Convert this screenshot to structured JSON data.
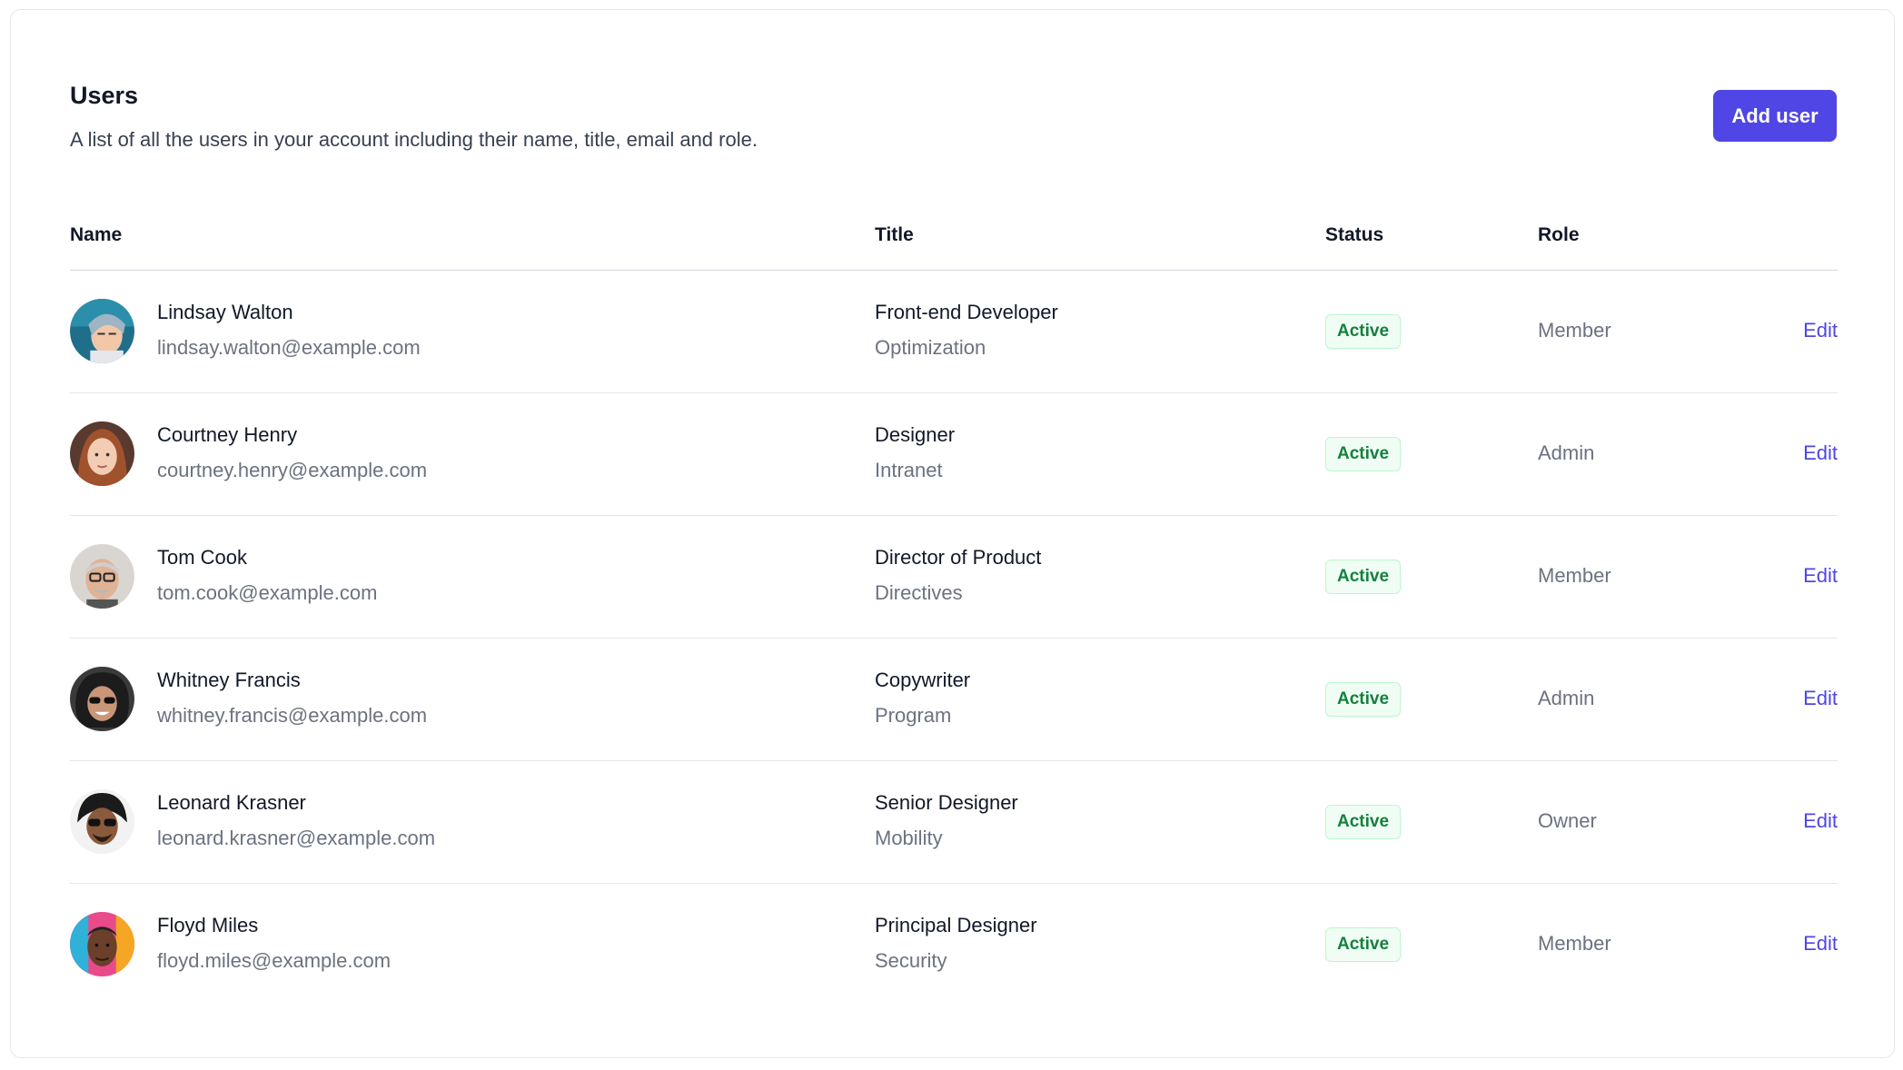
{
  "header": {
    "title": "Users",
    "subtitle": "A list of all the users in your account including their name, title, email and role.",
    "add_button_label": "Add user"
  },
  "table": {
    "columns": [
      "Name",
      "Title",
      "Status",
      "Role"
    ],
    "rows": [
      {
        "name": "Lindsay Walton",
        "email": "lindsay.walton@example.com",
        "title": "Front-end Developer",
        "department": "Optimization",
        "status": "Active",
        "role": "Member",
        "action": "Edit"
      },
      {
        "name": "Courtney Henry",
        "email": "courtney.henry@example.com",
        "title": "Designer",
        "department": "Intranet",
        "status": "Active",
        "role": "Admin",
        "action": "Edit"
      },
      {
        "name": "Tom Cook",
        "email": "tom.cook@example.com",
        "title": "Director of Product",
        "department": "Directives",
        "status": "Active",
        "role": "Member",
        "action": "Edit"
      },
      {
        "name": "Whitney Francis",
        "email": "whitney.francis@example.com",
        "title": "Copywriter",
        "department": "Program",
        "status": "Active",
        "role": "Admin",
        "action": "Edit"
      },
      {
        "name": "Leonard Krasner",
        "email": "leonard.krasner@example.com",
        "title": "Senior Designer",
        "department": "Mobility",
        "status": "Active",
        "role": "Owner",
        "action": "Edit"
      },
      {
        "name": "Floyd Miles",
        "email": "floyd.miles@example.com",
        "title": "Principal Designer",
        "department": "Security",
        "status": "Active",
        "role": "Member",
        "action": "Edit"
      }
    ]
  },
  "colors": {
    "accent": "#4f46e5",
    "badge_bg": "#f0fdf4",
    "badge_text": "#15803d",
    "badge_border": "#bbf7d0"
  }
}
